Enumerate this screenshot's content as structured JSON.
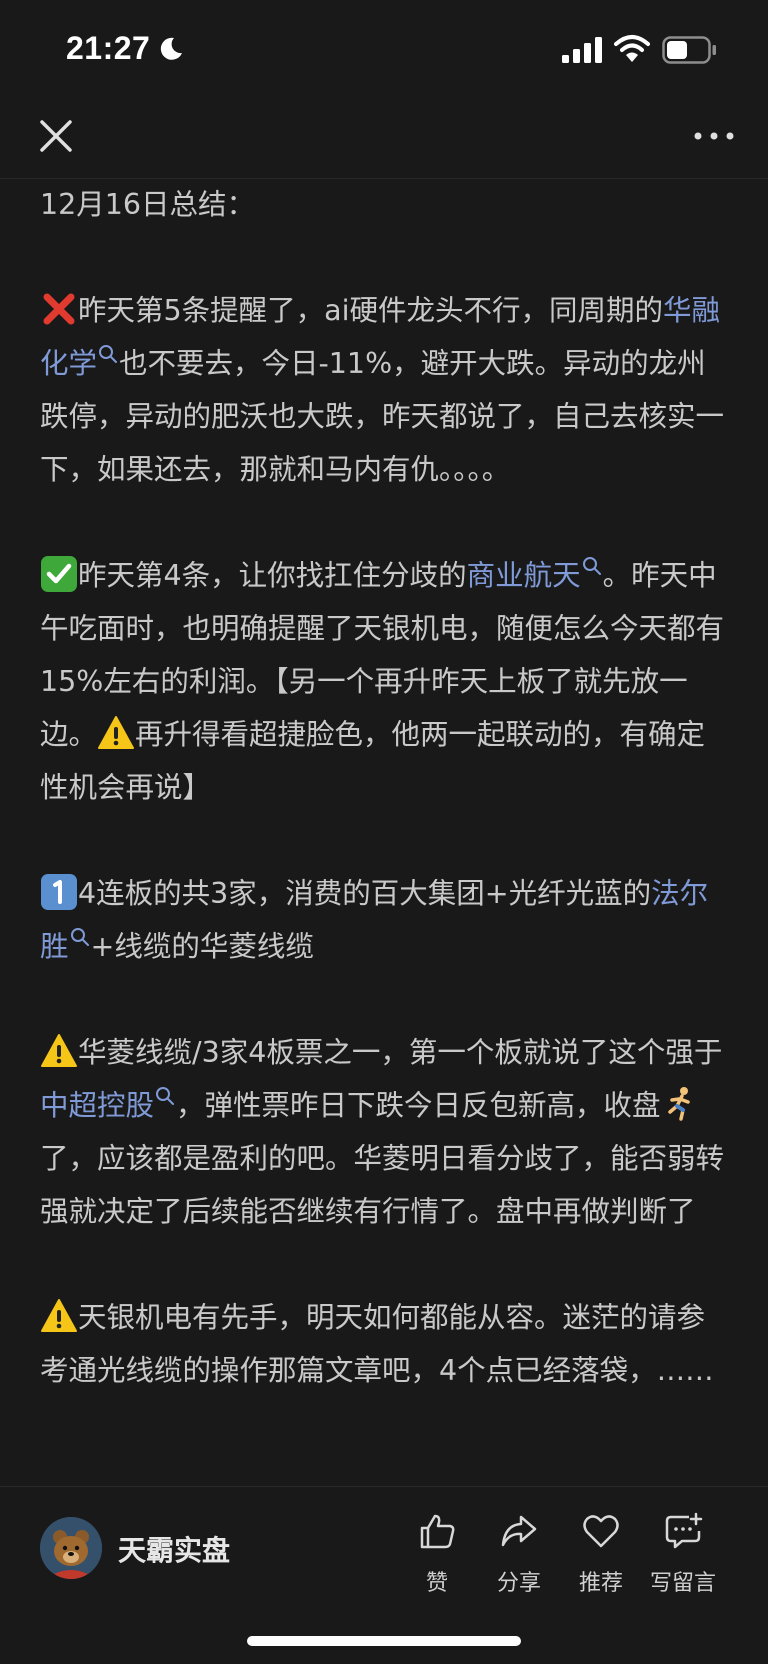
{
  "status_bar": {
    "time": "21:27",
    "icons": [
      "moon-icon",
      "signal-icon",
      "wifi-icon",
      "battery-icon"
    ]
  },
  "nav": {
    "close_icon": "close-icon",
    "more_icon": "more-icon"
  },
  "article": {
    "heading": "12月16日总结：",
    "p1": {
      "emoji": "cross-mark-icon",
      "t1": "昨天第5条提醒了，ai硬件龙头不行，同周期的",
      "link1": "华融化学",
      "t2": "也不要去，今日-11%，避开大跌。异动的龙州跌停，异动的肥沃也大跌，昨天都说了，自己去核实一下，如果还去，那就和马内有仇。。。。"
    },
    "p2": {
      "emoji": "check-mark-icon",
      "t1": "昨天第4条，让你找扛住分歧的",
      "link1": "商业航天",
      "t2": "。昨天中午吃面时，也明确提醒了天银机电，随便怎么今天都有15%左右的利润。【另一个再升昨天上板了就先放一边。",
      "t3": "再升得看超捷脸色，他两一起联动的，有确定性机会再说】"
    },
    "p3": {
      "emoji": "keycap-1-icon",
      "t1": "4连板的共3家，消费的百大集团+光纤光蓝的",
      "link1": "法尔胜",
      "t2": "+线缆的华菱线缆"
    },
    "p4": {
      "emoji": "warning-icon",
      "t1": "华菱线缆/3家4板票之一，第一个板就说了这个强于",
      "link1": "中超控股",
      "t2": "，弹性票昨日下跌今日反包新高，收盘",
      "t3": "了，应该都是盈利的吧。华菱明日看分歧了，能否弱转强就决定了后续能否继续有行情了。盘中再做判断了"
    },
    "p5": {
      "emoji": "warning-icon",
      "t1": "天银机电有先手，明天如何都能从容。迷茫的请参考通光线缆的操作那篇文章吧，4个点已经落袋，……"
    }
  },
  "footer": {
    "author": "天霸实盘",
    "actions": [
      {
        "label": "赞",
        "icon": "thumbs-up-icon"
      },
      {
        "label": "分享",
        "icon": "share-icon"
      },
      {
        "label": "推荐",
        "icon": "heart-icon"
      },
      {
        "label": "写留言",
        "icon": "comment-icon"
      }
    ]
  },
  "colors": {
    "background": "#191919",
    "text": "#c9c9c9",
    "link": "#7f9ad6"
  }
}
